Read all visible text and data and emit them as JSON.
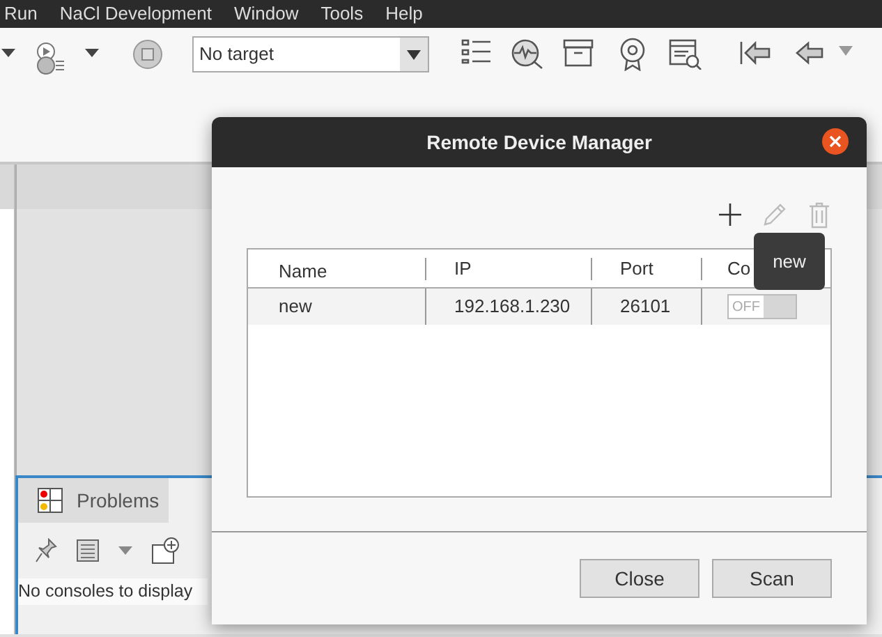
{
  "menu": [
    "Run",
    "NaCl Development",
    "Window",
    "Tools",
    "Help"
  ],
  "toolbar": {
    "target_combo": {
      "value": "No target"
    }
  },
  "bottom_panel": {
    "tabs": [
      {
        "label": "Problems",
        "selected": false
      }
    ],
    "message": "No consoles to display"
  },
  "dialog": {
    "title": "Remote Device Manager",
    "actions": [
      {
        "kind": "add",
        "disabled": false
      },
      {
        "kind": "edit",
        "disabled": true
      },
      {
        "kind": "delete",
        "disabled": true
      }
    ],
    "table": {
      "columns": [
        "Name",
        "IP",
        "Port",
        "Co"
      ],
      "rows": [
        {
          "name": "new",
          "ip": "192.168.1.230",
          "port": "26101",
          "connect": {
            "label": "OFF",
            "on": false
          }
        }
      ]
    },
    "tooltip": "new",
    "buttons": [
      "Close",
      "Scan"
    ]
  }
}
